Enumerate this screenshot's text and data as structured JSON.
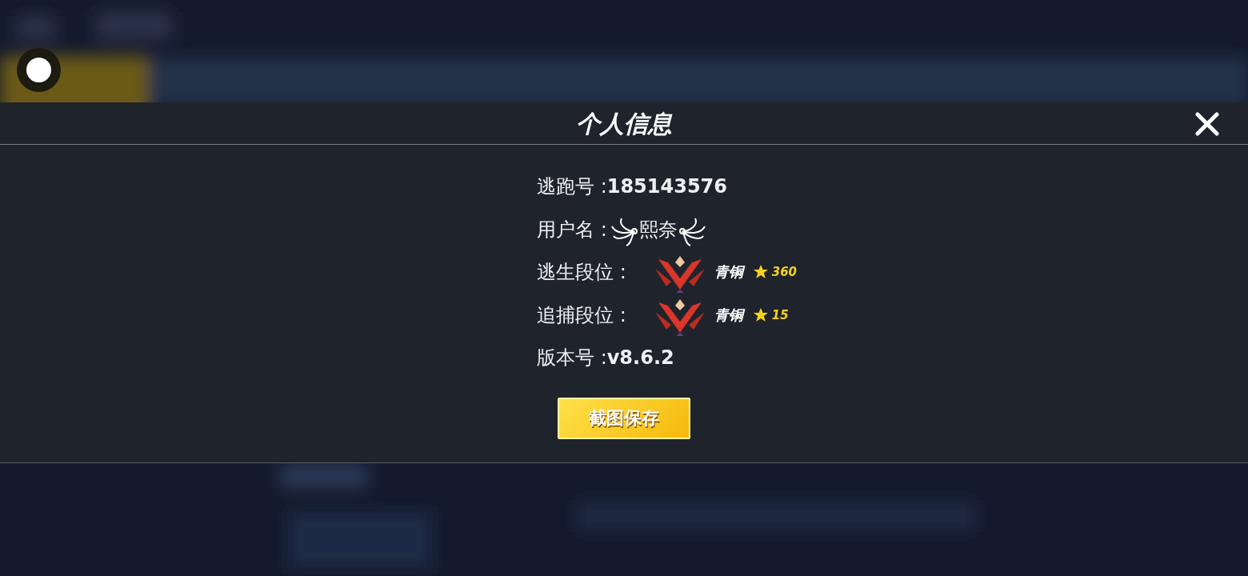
{
  "modal": {
    "title": "个人信息",
    "fields": [
      {
        "kind": "text",
        "label": "逃跑号 :",
        "value": "185143576"
      },
      {
        "kind": "name",
        "label": "用户名 :",
        "value": "熙奈"
      },
      {
        "kind": "rank",
        "label": "逃生段位 :",
        "rank": "青铜",
        "points": "360"
      },
      {
        "kind": "rank",
        "label": "追捕段位 :",
        "rank": "青铜",
        "points": "15"
      },
      {
        "kind": "text",
        "label": "版本号 :",
        "value": "v8.6.2"
      }
    ],
    "button": "截图保存"
  }
}
